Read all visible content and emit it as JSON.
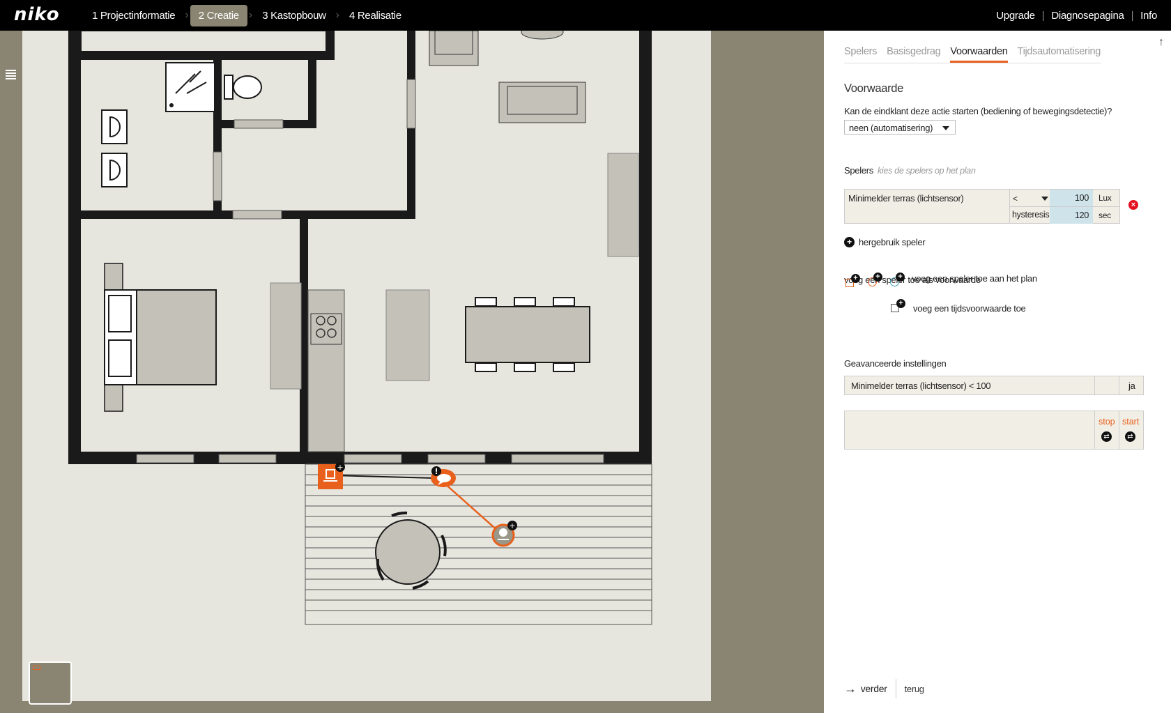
{
  "brand": {
    "logo": "niko"
  },
  "nav": {
    "steps": [
      {
        "label": "1 Projectinformatie"
      },
      {
        "label": "2 Creatie"
      },
      {
        "label": "3 Kastopbouw"
      },
      {
        "label": "4 Realisatie"
      }
    ],
    "right": [
      {
        "label": "Upgrade"
      },
      {
        "label": "Diagnosepagina"
      },
      {
        "label": "Info"
      }
    ]
  },
  "panel": {
    "tabs": [
      {
        "label": "Spelers"
      },
      {
        "label": "Basisgedrag"
      },
      {
        "label": "Voorwaarden"
      },
      {
        "label": "Tijdsautomatisering"
      }
    ],
    "title": "Voorwaarde",
    "question": "Kan de eindklant deze actie starten (bediening of bewegingsdetectie)?",
    "select_value": "neen (automatisering)",
    "spelers_label": "Spelers",
    "spelers_hint": "kies de spelers op het plan",
    "player": {
      "name": "Minimelder terras (lichtsensor)",
      "operator": "<",
      "value": "100",
      "unit": "Lux",
      "hysteresis_label": "hysteresis",
      "hysteresis_value": "120",
      "hysteresis_unit": "sec"
    },
    "reuse_label": "hergebruik speler",
    "add_label": "voeg een speler toe als voorwaarde",
    "add_on_plan": "voeg een speler toe aan het plan",
    "add_time": "voeg een tijdsvoorwaarde toe",
    "advanced_label": "Geavanceerde instellingen",
    "advanced_row": "Minimelder terras (lichtsensor) < 100",
    "advanced_ja": "ja",
    "stop_label": "stop",
    "start_label": "start",
    "next_label": "verder",
    "back_label": "terug"
  },
  "colors": {
    "accent": "#e8601c",
    "topbar": "#000000",
    "background": "#8a8573",
    "floor": "#e6e5de",
    "furniture": "#c4c2b8",
    "value_cell": "#cfe3ea"
  }
}
